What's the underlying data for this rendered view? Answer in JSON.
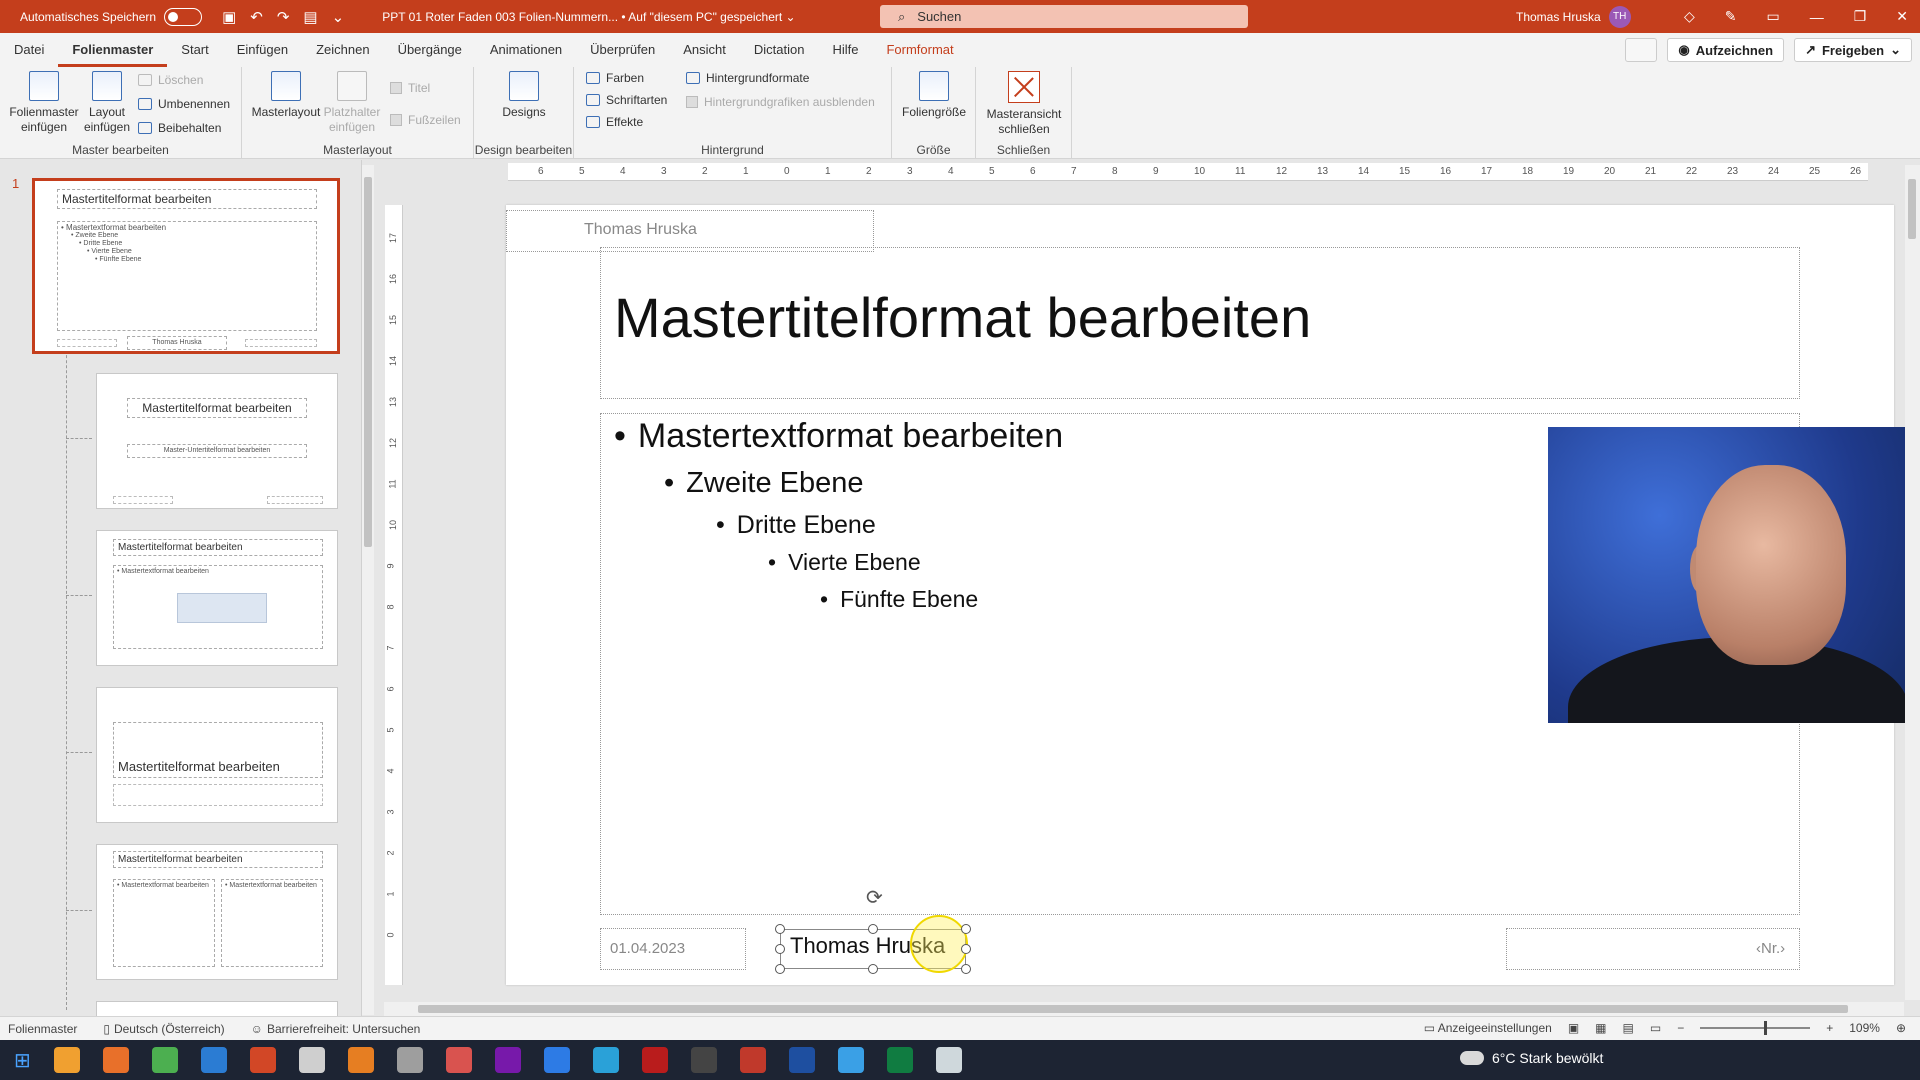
{
  "titlebar": {
    "autosave_label": "Automatisches Speichern",
    "doc_title": "PPT 01 Roter Faden 003 Folien-Nummern... • Auf \"diesem PC\" gespeichert ⌄",
    "search_placeholder": "Suchen",
    "user_name": "Thomas Hruska",
    "user_initials": "TH"
  },
  "menu": {
    "tabs": [
      "Datei",
      "Folienmaster",
      "Start",
      "Einfügen",
      "Zeichnen",
      "Übergänge",
      "Animationen",
      "Überprüfen",
      "Ansicht",
      "Dictation",
      "Hilfe",
      "Formformat"
    ],
    "record_label": "Aufzeichnen",
    "share_label": "Freigeben"
  },
  "ribbon": {
    "g1": {
      "label": "Master bearbeiten",
      "insert_master": "Folienmaster einfügen",
      "insert_layout": "Layout einfügen",
      "delete": "Löschen",
      "rename": "Umbenennen",
      "keep": "Beibehalten"
    },
    "g2": {
      "label": "Masterlayout",
      "masterlayout": "Masterlayout",
      "placeholder": "Platzhalter einfügen",
      "title": "Titel",
      "footer": "Fußzeilen"
    },
    "g3": {
      "label": "Design bearbeiten",
      "designs": "Designs"
    },
    "g4": {
      "label": "Hintergrund",
      "colors": "Farben",
      "fonts": "Schriftarten",
      "effects": "Effekte",
      "bgformats": "Hintergrundformate",
      "hidebg": "Hintergrundgrafiken ausblenden"
    },
    "g5": {
      "label": "Größe",
      "slidesize": "Foliengröße"
    },
    "g6": {
      "label": "Schließen",
      "close": "Masteransicht schließen"
    }
  },
  "thumbnails": {
    "number": "1",
    "master_title": "Mastertitelformat bearbeiten",
    "master_body": [
      "• Mastertextformat bearbeiten",
      "• Zweite Ebene",
      "• Dritte Ebene",
      "• Vierte Ebene",
      "• Fünfte Ebene"
    ],
    "master_footer": "Thomas Hruska",
    "layout1_title": "Mastertitelformat bearbeiten",
    "layout1_sub": "Master-Untertitelformat bearbeiten",
    "layout2_title": "Mastertitelformat bearbeiten",
    "layout2_body": "• Mastertextformat bearbeiten",
    "layout3_title": "Mastertitelformat bearbeiten",
    "layout4_title": "Mastertitelformat bearbeiten",
    "layout4_body": "• Mastertextformat bearbeiten"
  },
  "ruler": {
    "h": [
      "6",
      "5",
      "4",
      "3",
      "2",
      "1",
      "0",
      "1",
      "2",
      "3",
      "4",
      "5",
      "6",
      "7",
      "8",
      "9",
      "10",
      "11",
      "12",
      "13",
      "14",
      "15",
      "16",
      "17",
      "18",
      "19",
      "20",
      "21",
      "22",
      "23",
      "24",
      "25",
      "26"
    ],
    "v": [
      "17",
      "16",
      "15",
      "14",
      "13",
      "12",
      "11",
      "10",
      "9",
      "8",
      "7",
      "6",
      "5",
      "4",
      "3",
      "2",
      "1",
      "0"
    ]
  },
  "slide": {
    "header": "Thomas Hruska",
    "title": "Mastertitelformat bearbeiten",
    "level1": "Mastertextformat bearbeiten",
    "level2": "Zweite Ebene",
    "level3": "Dritte Ebene",
    "level4": "Vierte Ebene",
    "level5": "Fünfte Ebene",
    "date": "01.04.2023",
    "footer": "Thomas Hruska",
    "number": "‹Nr.›"
  },
  "status": {
    "view": "Folienmaster",
    "language": "Deutsch (Österreich)",
    "accessibility": "Barrierefreiheit: Untersuchen",
    "display_settings": "Anzeigeeinstellungen",
    "zoom": "109%"
  },
  "taskbar": {
    "weather": "6°C  Stark bewölkt",
    "icon_colors": [
      "#f0a030",
      "#e8702a",
      "#4caf50",
      "#2b7cd3",
      "#d24726",
      "#cfcfcf",
      "#e67e22",
      "#9e9e9e",
      "#d9534f",
      "#7719aa",
      "#2d7be5",
      "#2aa1d8",
      "#b91c1c",
      "#444444",
      "#c0392b",
      "#1e4fa0",
      "#3aa0e6",
      "#107c41",
      "#cfd8dc"
    ]
  }
}
